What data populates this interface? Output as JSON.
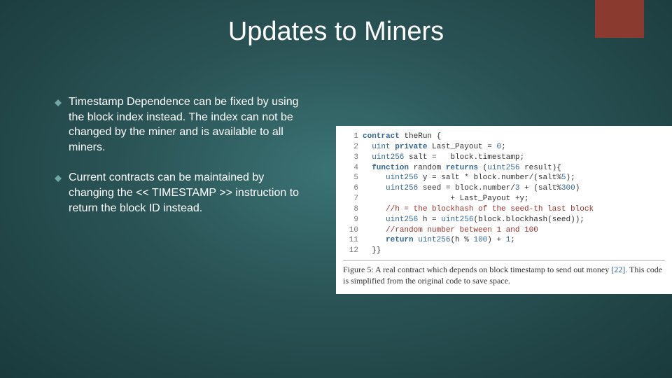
{
  "accentColor": "#8b3a2f",
  "title": "Updates to Miners",
  "bullets": [
    {
      "text": "Timestamp Dependence can be fixed by using the block index instead. The index can not be changed by the miner and is available to all miners."
    },
    {
      "text": "Current contracts can be maintained by changing the << TIMESTAMP >> instruction to return the block ID instead."
    }
  ],
  "code": {
    "lines": [
      {
        "n": "1",
        "segs": [
          {
            "c": "kw",
            "t": "contract"
          },
          {
            "c": "id",
            "t": " theRun {"
          }
        ]
      },
      {
        "n": "2",
        "segs": [
          {
            "c": "id",
            "t": "  "
          },
          {
            "c": "typ",
            "t": "uint"
          },
          {
            "c": "id",
            "t": " "
          },
          {
            "c": "kw",
            "t": "private"
          },
          {
            "c": "id",
            "t": " Last_Payout = "
          },
          {
            "c": "num",
            "t": "0"
          },
          {
            "c": "id",
            "t": ";"
          }
        ]
      },
      {
        "n": "3",
        "segs": [
          {
            "c": "id",
            "t": "  "
          },
          {
            "c": "typ",
            "t": "uint256"
          },
          {
            "c": "id",
            "t": " salt =   block.timestamp;"
          }
        ]
      },
      {
        "n": "4",
        "segs": [
          {
            "c": "id",
            "t": "  "
          },
          {
            "c": "kw",
            "t": "function"
          },
          {
            "c": "id",
            "t": " random "
          },
          {
            "c": "kw",
            "t": "returns"
          },
          {
            "c": "id",
            "t": " ("
          },
          {
            "c": "typ",
            "t": "uint256"
          },
          {
            "c": "id",
            "t": " result){"
          }
        ]
      },
      {
        "n": "5",
        "segs": [
          {
            "c": "id",
            "t": "     "
          },
          {
            "c": "typ",
            "t": "uint256"
          },
          {
            "c": "id",
            "t": " y = salt * block.number/(salt%"
          },
          {
            "c": "num",
            "t": "5"
          },
          {
            "c": "id",
            "t": ");"
          }
        ]
      },
      {
        "n": "6",
        "segs": [
          {
            "c": "id",
            "t": "     "
          },
          {
            "c": "typ",
            "t": "uint256"
          },
          {
            "c": "id",
            "t": " seed = block.number/"
          },
          {
            "c": "num",
            "t": "3"
          },
          {
            "c": "id",
            "t": " + (salt%"
          },
          {
            "c": "num",
            "t": "300"
          },
          {
            "c": "id",
            "t": ")"
          }
        ]
      },
      {
        "n": "7",
        "segs": [
          {
            "c": "id",
            "t": "                   + Last_Payout +y;"
          }
        ]
      },
      {
        "n": "8",
        "segs": [
          {
            "c": "id",
            "t": "     "
          },
          {
            "c": "cmt",
            "t": "//h = the blockhash of the seed-th last block"
          }
        ]
      },
      {
        "n": "9",
        "segs": [
          {
            "c": "id",
            "t": "     "
          },
          {
            "c": "typ",
            "t": "uint256"
          },
          {
            "c": "id",
            "t": " h = "
          },
          {
            "c": "typ",
            "t": "uint256"
          },
          {
            "c": "id",
            "t": "(block.blockhash(seed));"
          }
        ]
      },
      {
        "n": "10",
        "segs": [
          {
            "c": "id",
            "t": "     "
          },
          {
            "c": "cmt",
            "t": "//random number between 1 and 100"
          }
        ]
      },
      {
        "n": "11",
        "segs": [
          {
            "c": "id",
            "t": "     "
          },
          {
            "c": "kw",
            "t": "return"
          },
          {
            "c": "id",
            "t": " "
          },
          {
            "c": "typ",
            "t": "uint256"
          },
          {
            "c": "id",
            "t": "(h % "
          },
          {
            "c": "num",
            "t": "100"
          },
          {
            "c": "id",
            "t": ") + "
          },
          {
            "c": "num",
            "t": "1"
          },
          {
            "c": "id",
            "t": ";"
          }
        ]
      },
      {
        "n": "12",
        "segs": [
          {
            "c": "id",
            "t": "  }}"
          }
        ]
      }
    ],
    "caption_prefix": "Figure 5: A real contract which depends on block timestamp to send out money ",
    "caption_ref": "[22]",
    "caption_suffix": ". This code is simplified from the original code to save space."
  }
}
